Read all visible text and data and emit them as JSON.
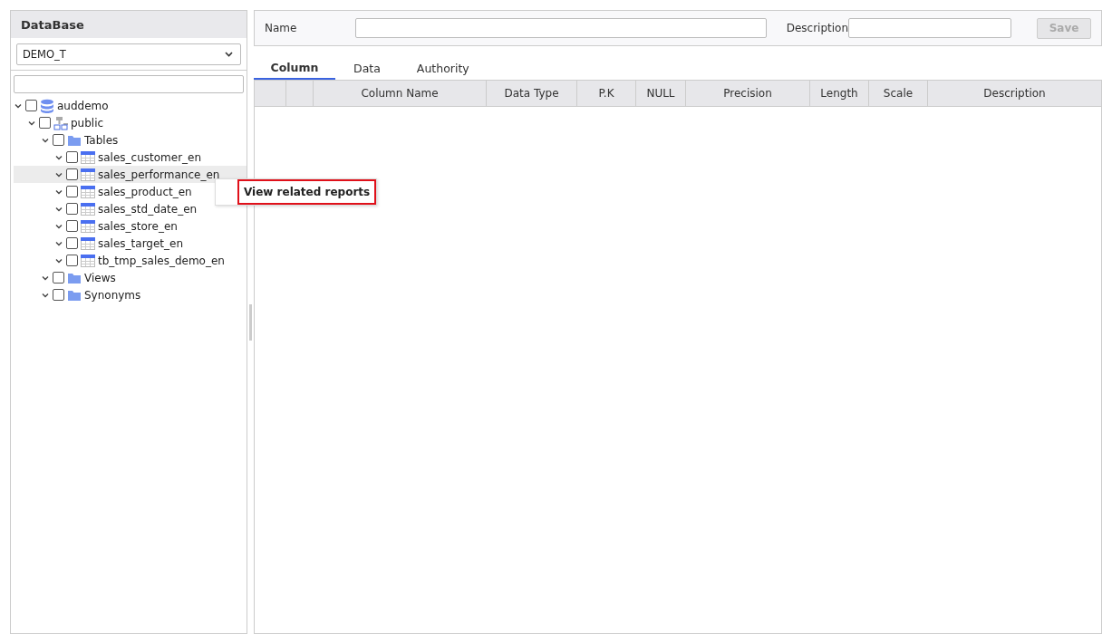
{
  "sidebar": {
    "title": "DataBase",
    "database_select": {
      "value": "DEMO_T"
    },
    "tree": [
      {
        "kind": "database",
        "label": "auddemo",
        "expanded": true,
        "checked": false,
        "selected": false,
        "children": [
          {
            "kind": "schema",
            "label": "public",
            "expanded": true,
            "checked": false,
            "selected": false,
            "children": [
              {
                "kind": "folder",
                "label": "Tables",
                "expanded": true,
                "checked": false,
                "selected": false,
                "children": [
                  {
                    "kind": "table",
                    "label": "sales_customer_en",
                    "expanded": true,
                    "checked": false,
                    "selected": false
                  },
                  {
                    "kind": "table",
                    "label": "sales_performance_en",
                    "expanded": true,
                    "checked": false,
                    "selected": true
                  },
                  {
                    "kind": "table",
                    "label": "sales_product_en",
                    "expanded": true,
                    "checked": false,
                    "selected": false
                  },
                  {
                    "kind": "table",
                    "label": "sales_std_date_en",
                    "expanded": true,
                    "checked": false,
                    "selected": false
                  },
                  {
                    "kind": "table",
                    "label": "sales_store_en",
                    "expanded": true,
                    "checked": false,
                    "selected": false
                  },
                  {
                    "kind": "table",
                    "label": "sales_target_en",
                    "expanded": true,
                    "checked": false,
                    "selected": false
                  },
                  {
                    "kind": "table",
                    "label": "tb_tmp_sales_demo_en",
                    "expanded": true,
                    "checked": false,
                    "selected": false
                  }
                ]
              },
              {
                "kind": "folder",
                "label": "Views",
                "expanded": true,
                "checked": false,
                "selected": false
              },
              {
                "kind": "folder",
                "label": "Synonyms",
                "expanded": true,
                "checked": false,
                "selected": false
              }
            ]
          }
        ]
      }
    ]
  },
  "context_menu": {
    "items": [
      {
        "label": "View related reports",
        "selected": true
      }
    ]
  },
  "form": {
    "name_label": "Name",
    "description_label": "Description",
    "save_button": {
      "label": "Save",
      "disabled": true
    }
  },
  "tabs": [
    {
      "label": "Column",
      "selected": true
    },
    {
      "label": "Data",
      "selected": false
    },
    {
      "label": "Authority",
      "selected": false
    }
  ],
  "table": {
    "columns": [
      "",
      "",
      "Column Name",
      "Data Type",
      "P.K",
      "NULL",
      "Precision",
      "Length",
      "Scale",
      "Description"
    ]
  }
}
